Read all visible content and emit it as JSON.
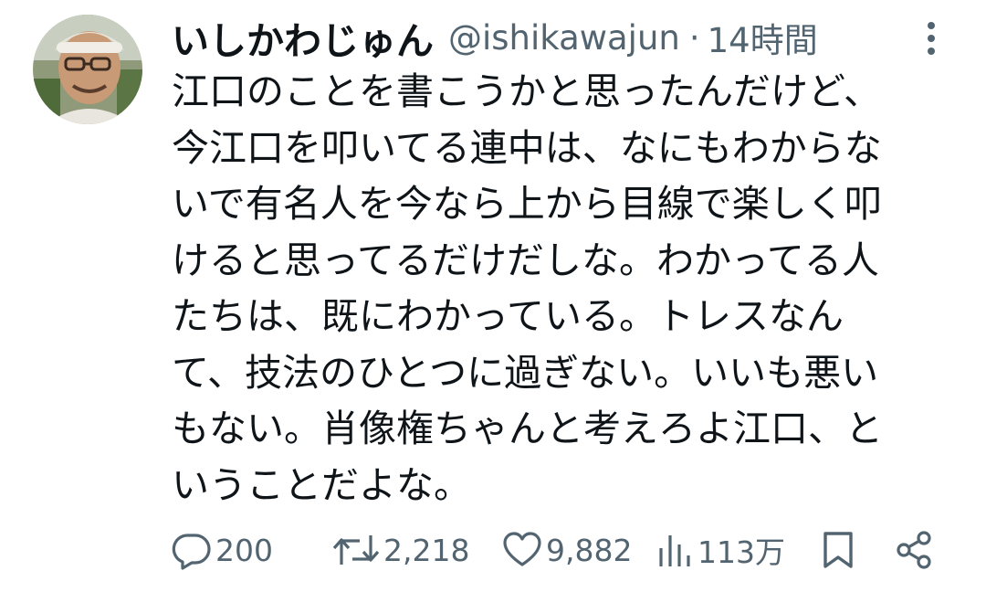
{
  "tweet": {
    "display_name": "いしかわじゅん",
    "handle": "@ishikawajun",
    "separator": "·",
    "time": "14時間",
    "text_lines": [
      "江口のことを書こうかと思ったんだけど、",
      "今江口を叩いてる連中は、なにもわからな",
      "いで有名人を今なら上から目線で楽しく叩",
      "けると思ってるだけだしな。わかってる人",
      "たちは、既にわかっている。トレスなん",
      "て、技法のひとつに過ぎない。いいも悪い",
      "もない。肖像権ちゃんと考えろよ江口、と",
      "いうことだよな。"
    ]
  },
  "actions": {
    "replies": "200",
    "retweets": "2,218",
    "likes": "9,882",
    "views": "113万"
  },
  "icons": {
    "more": "more-vertical-icon",
    "reply": "reply-bubble-icon",
    "retweet": "retweet-icon",
    "like": "heart-icon",
    "views": "bar-chart-icon",
    "bookmark": "bookmark-icon",
    "share": "share-icon"
  },
  "colors": {
    "text": "#0f1419",
    "secondary": "#536471"
  }
}
